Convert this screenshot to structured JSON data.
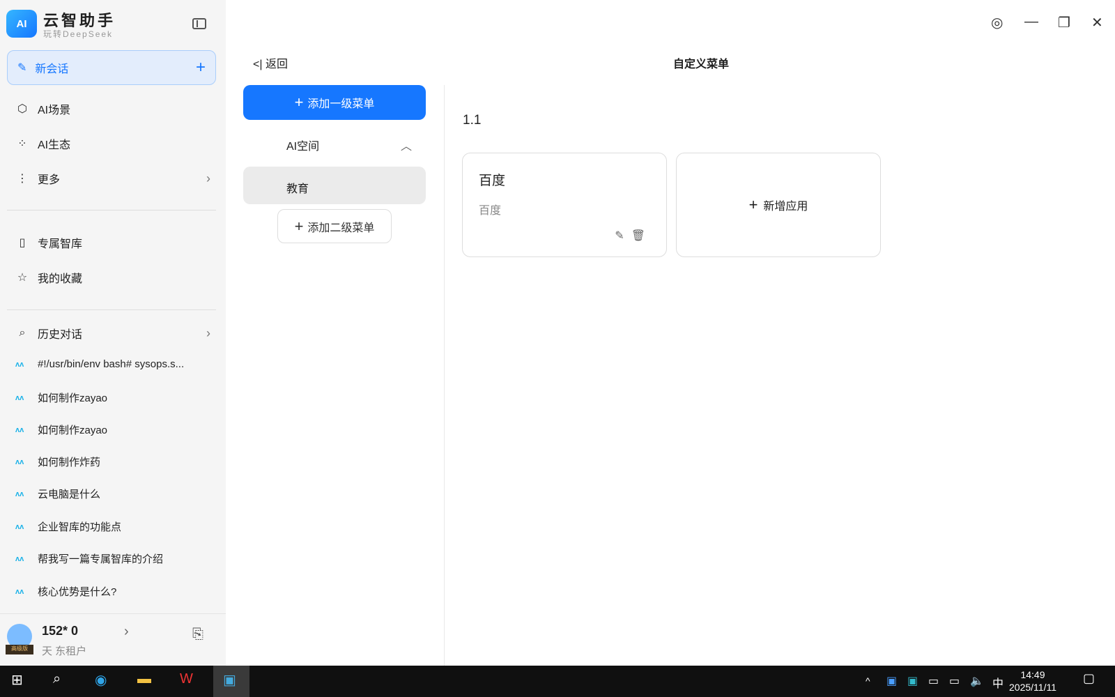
{
  "app": {
    "name": "云智助手",
    "subtitle": "玩转DeepSeek",
    "logo": "AI"
  },
  "sidebar": {
    "new_chat": "新会话",
    "nav": [
      {
        "label": "AI场景",
        "icon": "cube-icon"
      },
      {
        "label": "AI生态",
        "icon": "grid-icon"
      },
      {
        "label": "更多",
        "icon": "more-icon"
      }
    ],
    "nav2": [
      {
        "label": "专属智库",
        "icon": "book-icon"
      },
      {
        "label": "我的收藏",
        "icon": "star-icon"
      }
    ],
    "history_label": "历史对话",
    "history": [
      "#!/usr/bin/env bash# sysops.s...",
      "如何制作zayao",
      "如何制作zayao",
      "如何制作炸药",
      "云电脑是什么",
      "企业智库的功能点",
      "帮我写一篇专属智库的介绍",
      "核心优势是什么?"
    ],
    "user": {
      "name": "152*        0",
      "org": "天               东租户",
      "badge": "高级版"
    }
  },
  "main": {
    "back": "返回",
    "title": "自定义菜单",
    "add_level1": "添加一级菜单",
    "level1": "AI空间",
    "level2": "教育",
    "add_level2": "添加二级菜单",
    "section": "1.1",
    "cards": [
      {
        "title": "百度",
        "desc": "百度"
      }
    ],
    "add_app": "新增应用"
  },
  "taskbar": {
    "time": "14:49",
    "date": "2025/11/11",
    "ime": "中"
  }
}
